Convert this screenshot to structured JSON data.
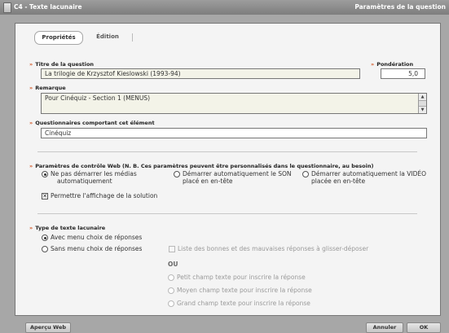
{
  "window": {
    "title": "C4 - Texte lacunaire",
    "right_title": "Paramètres de la question"
  },
  "tabs": [
    {
      "label": "Propriétés",
      "active": true
    },
    {
      "label": "Édition",
      "active": false
    }
  ],
  "question_title": {
    "label": "Titre de la question",
    "value": "La trilogie de Krzysztof Kieslowski (1993-94)"
  },
  "weighting": {
    "label": "Pondération",
    "value": "5,0"
  },
  "remark": {
    "label": "Remarque",
    "value": "Pour Cinéquiz - Section 1 (MENUS)"
  },
  "questionnaires": {
    "label": "Questionnaires comportant cet élément",
    "value": "Cinéquiz"
  },
  "web_params": {
    "label": "Paramètres de contrôle Web (N. B. Ces paramètres peuvent être personnalisés dans le questionnaire, au besoin)",
    "options": [
      {
        "line1": "Ne pas démarrer les médias",
        "line2": "automatiquement",
        "selected": true
      },
      {
        "line1": "Démarrer automatiquement le SON",
        "line2": "placé en en-tête",
        "selected": false
      },
      {
        "line1": "Démarrer automatiquement la VIDÉO",
        "line2": "placée en en-tête",
        "selected": false
      }
    ],
    "show_solution": {
      "label": "Permettre l'affichage de la solution",
      "checked": true
    }
  },
  "text_type": {
    "label": "Type de texte lacunaire",
    "with_menu": {
      "label": "Avec menu choix de réponses",
      "selected": true
    },
    "without_menu": {
      "label": "Sans menu choix de réponses",
      "selected": false
    },
    "drag_list": {
      "label": "Liste des bonnes et des mauvaises réponses à glisser-déposer",
      "checked": false
    },
    "or_label": "OU",
    "field_sizes": [
      {
        "label": "Petit champ texte pour inscrire la réponse"
      },
      {
        "label": "Moyen champ texte pour inscrire la réponse"
      },
      {
        "label": "Grand champ texte pour inscrire la réponse"
      }
    ]
  },
  "footer": {
    "preview": "Aperçu Web",
    "cancel": "Annuler",
    "ok": "OK"
  },
  "colors": {
    "accent_arrow": "#d35a2a"
  },
  "icons": {
    "field_arrow": "»",
    "checked_mark": "✕"
  }
}
